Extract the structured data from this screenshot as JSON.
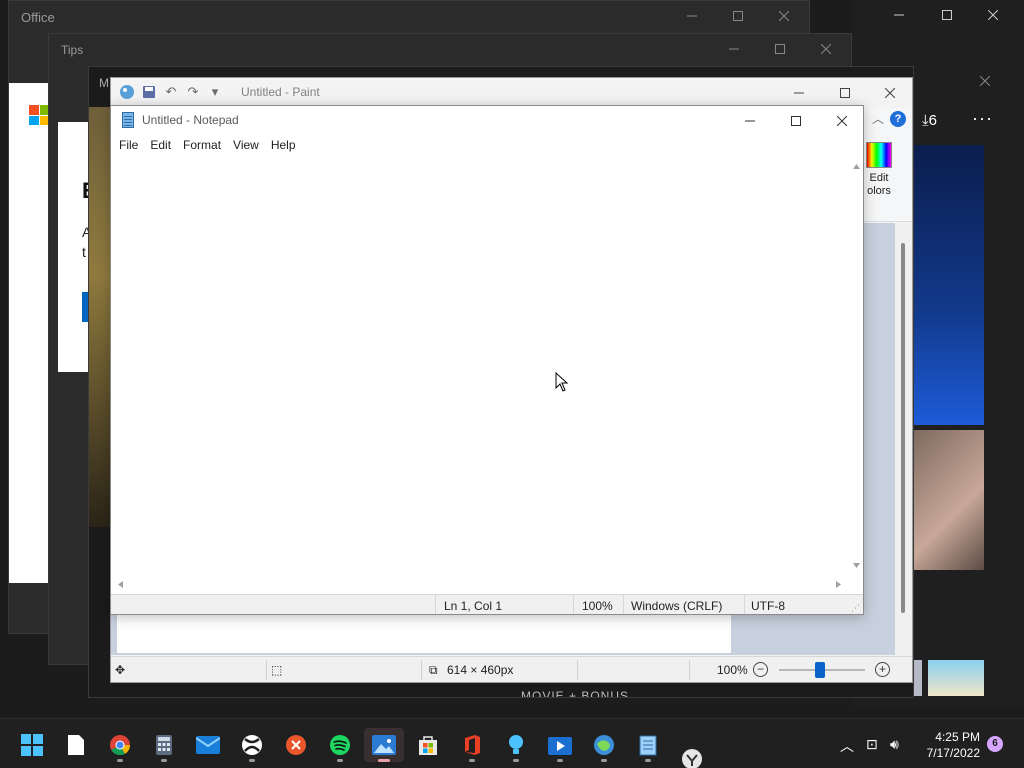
{
  "windows": {
    "office": {
      "title": "Office"
    },
    "tips": {
      "title": "Tips",
      "heading": "E",
      "text_lines": [
        "A",
        "t"
      ]
    },
    "movies": {
      "title": "M",
      "caption": "MOVIE + BONUS"
    },
    "stream": {
      "downloads": "6",
      "more": "···"
    },
    "paint": {
      "title": "Untitled - Paint",
      "edit_colors_line1": "Edit",
      "edit_colors_line2": "olors",
      "help": "?",
      "status": {
        "dimensions": "614 × 460px",
        "zoom": "100%",
        "zoom_fraction": 0.5
      }
    },
    "notepad": {
      "title": "Untitled - Notepad",
      "menu": [
        "File",
        "Edit",
        "Format",
        "View",
        "Help"
      ],
      "content": "",
      "status": {
        "position": "Ln 1, Col 1",
        "zoom": "100%",
        "line_ending": "Windows (CRLF)",
        "encoding": "UTF-8"
      }
    }
  },
  "taskbar": {
    "apps": [
      "start",
      "file",
      "chrome",
      "calculator",
      "mail",
      "xbox",
      "office-x",
      "spotify",
      "photos",
      "store",
      "office",
      "tips",
      "movies",
      "maps",
      "notepad",
      "snip"
    ],
    "time": "4:25 PM",
    "date": "7/17/2022",
    "notifications": "6"
  },
  "colors": {
    "taskbar": "#202020",
    "accent": "#0067c0"
  }
}
